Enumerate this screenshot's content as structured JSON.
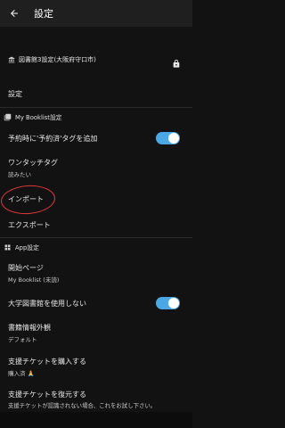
{
  "appbar": {
    "title": "設定"
  },
  "library_row": {
    "label": "図書館3設定(大阪府守口市)"
  },
  "settings_row": {
    "label": "設定"
  },
  "booklist_section": {
    "header": "My Booklist設定"
  },
  "reserved_tag": {
    "label": "予約時に'予約済'タグを追加",
    "enabled": true
  },
  "onetouch_tag": {
    "label": "ワンタッチタグ",
    "value": "読みたい"
  },
  "import_row": {
    "label": "インポート"
  },
  "export_row": {
    "label": "エクスポート"
  },
  "app_section": {
    "header": "App設定"
  },
  "start_page": {
    "label": "開始ページ",
    "value": "My Booklist (未読)"
  },
  "univ_library": {
    "label": "大学図書館を使用しない",
    "enabled": true
  },
  "book_info": {
    "label": "書籍情報外観",
    "value": "デフォルト"
  },
  "support_buy": {
    "label": "支援チケットを購入する",
    "value": "購入済 🙏"
  },
  "support_restore": {
    "label": "支援チケットを復元する",
    "value": "支援チケットが認識されない場合、これをお試し下さい。"
  },
  "colors": {
    "background": "#121212",
    "appbar": "#1f1f1f",
    "toggle": "#4aa8e6",
    "annotation": "#e53935"
  },
  "icons": [
    "back-arrow-icon",
    "library-icon",
    "lock-icon",
    "booklist-icon",
    "app-settings-icon"
  ]
}
